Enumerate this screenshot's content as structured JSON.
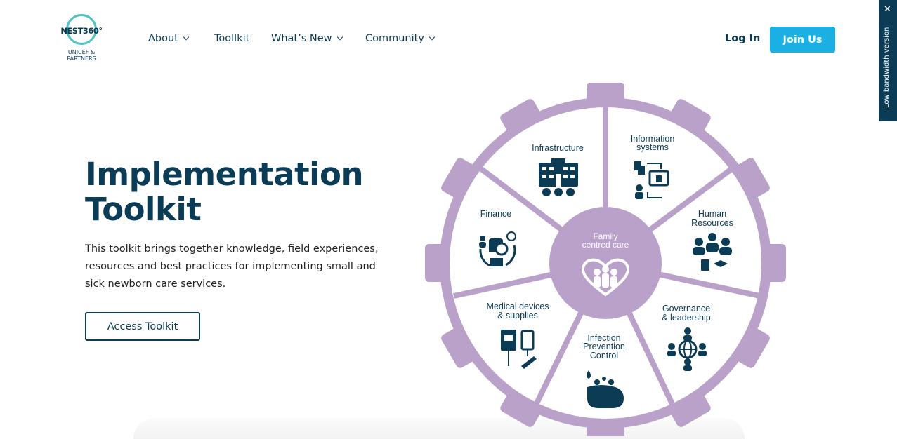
{
  "brand": {
    "name": "NEST360°",
    "sub": "UNICEF & PARTNERS"
  },
  "nav": {
    "about": "About",
    "toolkit": "Toollkit",
    "whats_new": "What’s New",
    "community": "Community"
  },
  "auth": {
    "login": "Log In",
    "join": "Join Us"
  },
  "low_bandwidth": "Low bandwidth version",
  "hero": {
    "title_line1": "Implementation",
    "title_line2": "Toolkit",
    "desc": "This toolkit brings together knowledge, field experiences, resources and best practices for implementing small and sick newborn care services.",
    "cta": "Access Toolkit"
  },
  "wheel": {
    "center_line1": "Family",
    "center_line2": "centred care",
    "infrastructure": "Infrastructure",
    "info_line1": "Information",
    "info_line2": "systems",
    "hr_line1": "Human",
    "hr_line2": "Resources",
    "gov_line1": "Governance",
    "gov_line2": "& leadership",
    "ipc_line1": "Infection",
    "ipc_line2": "Prevention",
    "ipc_line3": "Control",
    "med_line1": "Medical devices",
    "med_line2": "& supplies",
    "finance": "Finance"
  },
  "colors": {
    "accent": "#1bb0e4",
    "navy": "#0b3b55",
    "wheel": "#b9a1c9",
    "ring_teal": "#4fc2c6"
  }
}
